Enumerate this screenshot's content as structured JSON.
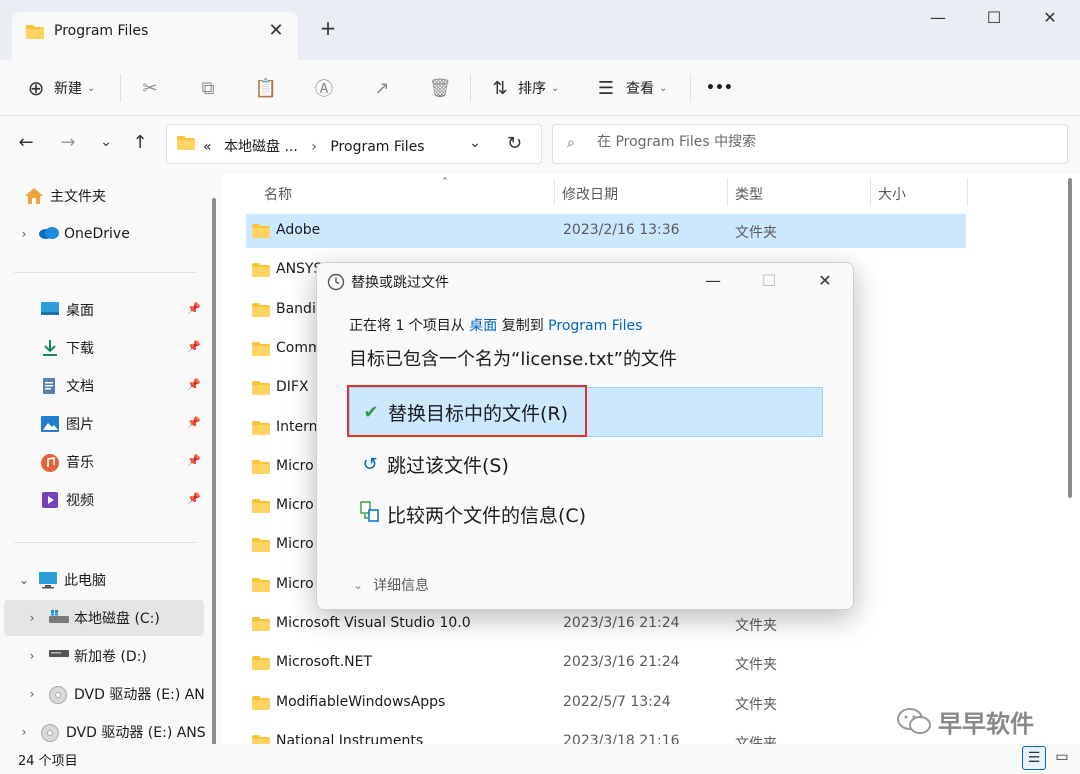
{
  "window": {
    "tab_title": "Program Files",
    "tab_close": "✕",
    "new_tab": "+",
    "minimize": "—",
    "maximize": "☐",
    "close": "✕"
  },
  "toolbar": {
    "new_label": "新建",
    "sort_label": "排序",
    "view_label": "查看",
    "more_label": "•••"
  },
  "address": {
    "prefix": "«",
    "segment1": "本地磁盘 ...",
    "segment2": "Program Files",
    "search_placeholder": "在 Program Files 中搜索"
  },
  "sidebar": {
    "home": "主文件夹",
    "onedrive": "OneDrive",
    "quick": [
      {
        "label": "桌面",
        "icon": "desktop-icon"
      },
      {
        "label": "下载",
        "icon": "download-icon"
      },
      {
        "label": "文档",
        "icon": "document-icon"
      },
      {
        "label": "图片",
        "icon": "picture-icon"
      },
      {
        "label": "音乐",
        "icon": "music-icon"
      },
      {
        "label": "视频",
        "icon": "video-icon"
      }
    ],
    "this_pc": "此电脑",
    "drives": [
      {
        "label": "本地磁盘 (C:)"
      },
      {
        "label": "新加卷 (D:)"
      },
      {
        "label": "DVD 驱动器 (E:) AN"
      },
      {
        "label": "DVD 驱动器 (E:) ANS"
      }
    ]
  },
  "columns": {
    "name": "名称",
    "modified": "修改日期",
    "type": "类型",
    "size": "大小"
  },
  "files": [
    {
      "name": "Adobe",
      "date": "2023/2/16 13:36",
      "type": "文件夹"
    },
    {
      "name": "ANSYS",
      "date": "",
      "type": ""
    },
    {
      "name": "Bandiz",
      "date": "",
      "type": ""
    },
    {
      "name": "Comm",
      "date": "",
      "type": ""
    },
    {
      "name": "DIFX",
      "date": "",
      "type": ""
    },
    {
      "name": "Intern",
      "date": "",
      "type": ""
    },
    {
      "name": "Micro",
      "date": "",
      "type": ""
    },
    {
      "name": "Micro",
      "date": "",
      "type": ""
    },
    {
      "name": "Micro",
      "date": "",
      "type": ""
    },
    {
      "name": "Micro",
      "date": "",
      "type": ""
    },
    {
      "name": "Microsoft Visual Studio 10.0",
      "date": "2023/3/16 21:24",
      "type": "文件夹"
    },
    {
      "name": "Microsoft.NET",
      "date": "2023/3/16 21:24",
      "type": "文件夹"
    },
    {
      "name": "ModifiableWindowsApps",
      "date": "2022/5/7 13:24",
      "type": "文件夹"
    },
    {
      "name": "National Instruments",
      "date": "2023/3/18 21:16",
      "type": "文件夹"
    }
  ],
  "status": {
    "count": "24 个项目"
  },
  "watermark": "早早软件",
  "dialog": {
    "title": "替换或跳过文件",
    "sub_prefix": "正在将 1 个项目从 ",
    "sub_source": "桌面",
    "sub_middle": " 复制到 ",
    "sub_dest": "Program Files",
    "heading": "目标已包含一个名为“license.txt”的文件",
    "replace": "替换目标中的文件(R)",
    "skip": "跳过该文件(S)",
    "compare": "比较两个文件的信息(C)",
    "details": "详细信息",
    "close": "✕",
    "minimize": "—",
    "maximize": "☐"
  },
  "colors": {
    "accent": "#0067c0",
    "selection": "#cce8ff",
    "highlight_box": "#e0312b",
    "folder": "#f8c53a"
  }
}
